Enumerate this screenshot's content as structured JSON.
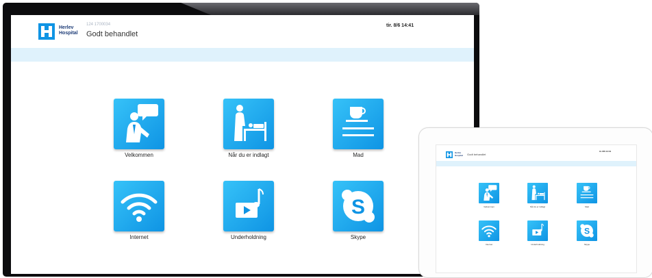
{
  "app": {
    "logo_text_line1": "Herlev",
    "logo_text_line2": "Hospital",
    "title": "Godt behandlet",
    "subtitle": "124 1700034",
    "datetime": "tir. 8/6 14:41"
  },
  "tiles": [
    {
      "label": "Velkommen",
      "icon": "doctor-speech-icon"
    },
    {
      "label": "Når du er indlagt",
      "icon": "patient-bed-icon"
    },
    {
      "label": "Mad",
      "icon": "food-cup-icon"
    },
    {
      "label": "Internet",
      "icon": "wifi-icon"
    },
    {
      "label": "Underholdning",
      "icon": "video-music-icon"
    },
    {
      "label": "Skype",
      "icon": "skype-icon"
    }
  ],
  "colors": {
    "tile_gradient_start": "#36c2f8",
    "tile_gradient_end": "#0f94e4",
    "strip": "#dff2fc",
    "logo_blue": "#1e3d78",
    "monitor_bezel": "#0c0c0e"
  }
}
